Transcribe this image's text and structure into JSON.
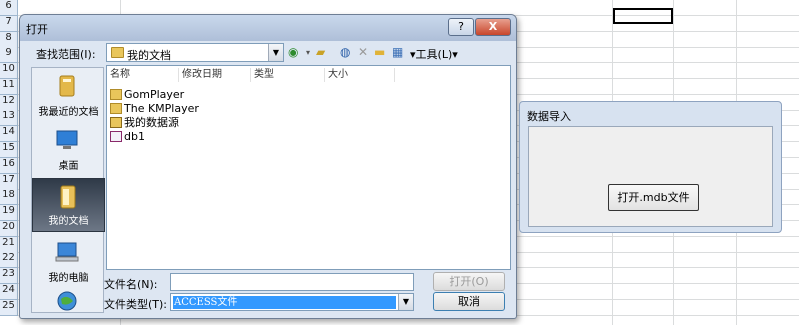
{
  "sheet": {
    "row_numbers": [
      "6",
      "7",
      "8",
      "9",
      "10",
      "11",
      "12",
      "13",
      "14",
      "15",
      "16",
      "17",
      "18",
      "19",
      "20",
      "21",
      "22",
      "23",
      "24",
      "25"
    ]
  },
  "open_dialog": {
    "title": "打开",
    "help_label": "?",
    "close_label": "X",
    "look_in_label": "查找范围(I):",
    "look_in_value": "我的文档",
    "tools_label": "▾工具(L)▾",
    "places": [
      {
        "label": "我最近的文档",
        "icon": "recent-documents-icon"
      },
      {
        "label": "桌面",
        "icon": "desktop-icon"
      },
      {
        "label": "我的文档",
        "icon": "my-documents-icon"
      },
      {
        "label": "我的电脑",
        "icon": "my-computer-icon"
      },
      {
        "label": "",
        "icon": "network-places-icon"
      }
    ],
    "columns": [
      "名称",
      "修改日期",
      "类型",
      "大小"
    ],
    "files": [
      {
        "name": "GomPlayer",
        "icon": "folder-icon"
      },
      {
        "name": "The KMPlayer",
        "icon": "folder-icon"
      },
      {
        "name": "我的数据源",
        "icon": "data-source-folder-icon"
      },
      {
        "name": "db1",
        "icon": "access-db-icon"
      }
    ],
    "filename_label": "文件名(N):",
    "filename_value": "",
    "filetype_label": "文件类型(T):",
    "filetype_value": "ACCESS文件",
    "open_button": "打开(O)",
    "cancel_button": "取消"
  },
  "import_dialog": {
    "title": "数据导入",
    "button": "打开.mdb文件"
  }
}
